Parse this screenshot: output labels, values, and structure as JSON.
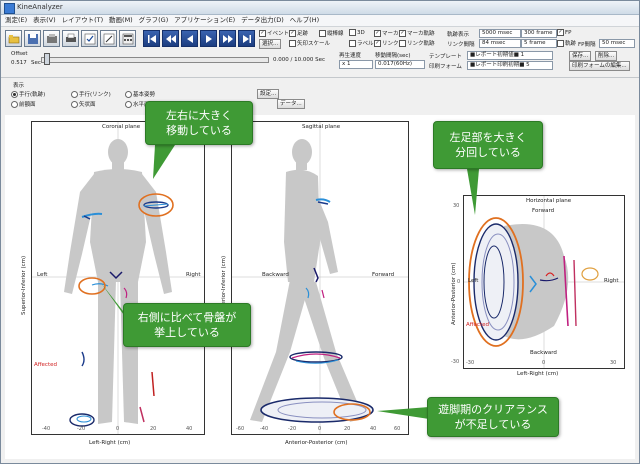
{
  "window": {
    "title": "KineAnalyzer"
  },
  "menu": [
    "測定(E)",
    "表示(V)",
    "レイアウト(T)",
    "動画(M)",
    "グラフ(G)",
    "アプリケーション(E)",
    "データ出力(D)",
    "ヘルプ(H)"
  ],
  "toolbar": {
    "checks": [
      "イベント",
      "足跡",
      "縦棒線",
      "3D",
      "ラベル",
      "リンク",
      "リンク軌跡",
      "マーカ",
      "マーカ軌跡",
      "FP",
      "軌跡"
    ],
    "select_button": "選択...",
    "bar_scale": "矢印スケール",
    "offset_label": "Offset",
    "offset_value": "0.517",
    "offset_unit": "Sec",
    "time_readout": "0.000 / 10.000 Sec",
    "speed_label": "再生速度",
    "speed_value": "x 1",
    "move_label": "移動間隔(sec)",
    "move_value": "0.017(60Hz)",
    "trajectory_label": "軌跡表示",
    "trajectory_value1": "5000 msec",
    "trajectory_value2": "300 frame",
    "link_interval_label": "リンク間隔",
    "link_interval_value1": "84 msec",
    "link_interval_value2": "5 frame",
    "fp_interval_label": "FP間隔",
    "fp_interval_value": "50 msec",
    "template_label": "テンプレート",
    "template_value": "■レポート初期値■ 1",
    "report_form_label": "印刷フォーム",
    "report_form_value": "■レポート印刷初期■ 5",
    "save_button": "保存...",
    "delete_button": "削除...",
    "edit_form_button": "印刷フォームの編集..."
  },
  "options": {
    "group_label": "表示",
    "radios": [
      "手行(軌跡)",
      "手行(リンク)",
      "基本姿勢",
      "前額面",
      "矢状面",
      "水平面"
    ],
    "settings_button": "設定...",
    "data_button": "データ..."
  },
  "panels": {
    "coronal": {
      "title": "Coronal plane",
      "xlabel": "Left-Right (cm)",
      "ylabel": "Superior-Inferior (cm)",
      "left_tag": "Left",
      "right_tag": "Right",
      "affected": "Affected",
      "ticks": [
        "-40",
        "-20",
        "0",
        "20",
        "40"
      ]
    },
    "sagittal": {
      "title": "Sagittal plane",
      "xlabel": "Anterior-Posterior (cm)",
      "ylabel": "Superior-Inferior (cm)",
      "back_tag": "Backward",
      "fwd_tag": "Forward",
      "ticks": [
        "-60",
        "-40",
        "-20",
        "0",
        "20",
        "40",
        "60"
      ]
    },
    "horizontal": {
      "title": "Horizontal plane",
      "xlabel": "Left-Right (cm)",
      "ylabel": "Anterior-Posterior (cm)",
      "left_tag": "Left",
      "right_tag": "Right",
      "fwd_tag": "Forward",
      "back_tag": "Backward",
      "affected": "Affected",
      "ticks": [
        "-30",
        "0",
        "30"
      ],
      "yticks": [
        "30",
        "0",
        "-30"
      ]
    }
  },
  "callouts": {
    "c1": "左右に大きく\n移動している",
    "c2": "右側に比べて骨盤が\n挙上している",
    "c3": "左足部を大きく\n分回している",
    "c4": "遊脚期のクリアランス\nが不足している"
  },
  "colors": {
    "callout": "#3f9a35",
    "highlight": "#e07020",
    "affected": "#d02020"
  }
}
